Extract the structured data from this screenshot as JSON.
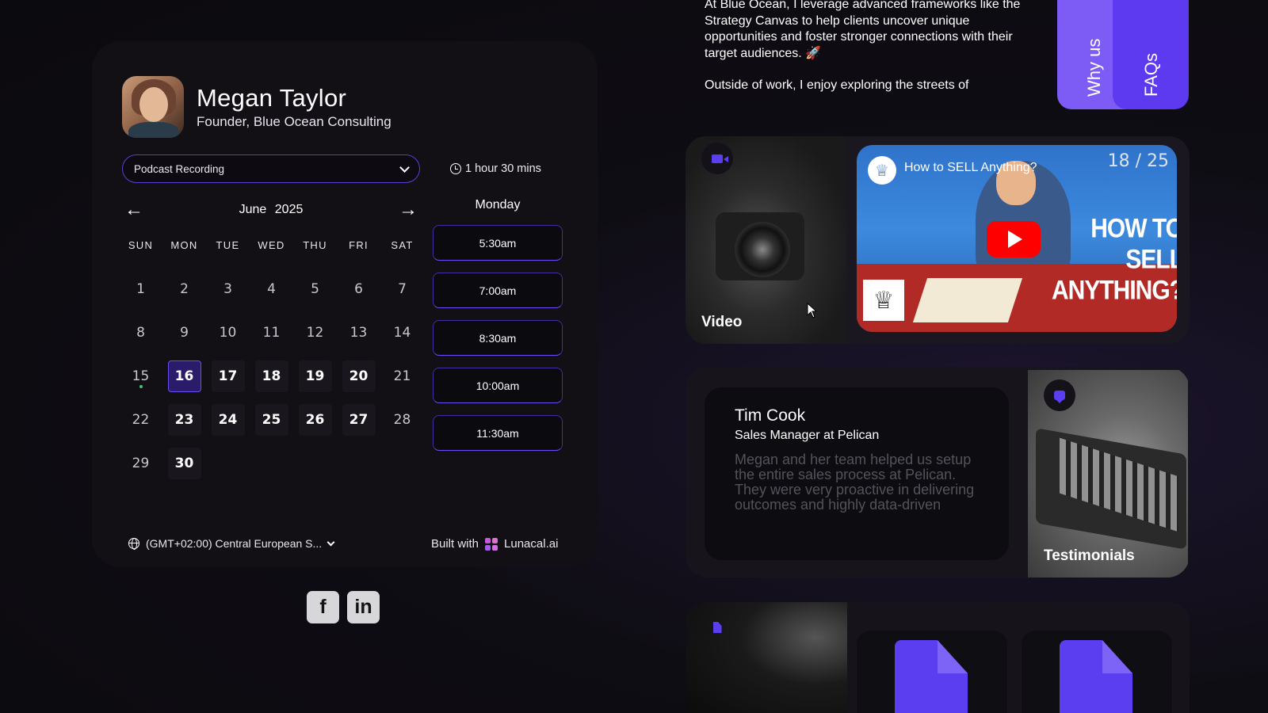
{
  "profile": {
    "name": "Megan Taylor",
    "role": "Founder, Blue Ocean Consulting"
  },
  "booking": {
    "event_type": "Podcast Recording",
    "duration": "1 hour 30 mins",
    "month": "June",
    "year": "2025",
    "weekdays": [
      "SUN",
      "MON",
      "TUE",
      "WED",
      "THU",
      "FRI",
      "SAT"
    ],
    "days": [
      {
        "d": "1",
        "state": "plain"
      },
      {
        "d": "2",
        "state": "plain"
      },
      {
        "d": "3",
        "state": "plain"
      },
      {
        "d": "4",
        "state": "plain"
      },
      {
        "d": "5",
        "state": "plain"
      },
      {
        "d": "6",
        "state": "plain"
      },
      {
        "d": "7",
        "state": "plain"
      },
      {
        "d": "8",
        "state": "plain"
      },
      {
        "d": "9",
        "state": "plain"
      },
      {
        "d": "10",
        "state": "plain"
      },
      {
        "d": "11",
        "state": "plain"
      },
      {
        "d": "12",
        "state": "plain"
      },
      {
        "d": "13",
        "state": "plain"
      },
      {
        "d": "14",
        "state": "plain"
      },
      {
        "d": "15",
        "state": "today"
      },
      {
        "d": "16",
        "state": "selected"
      },
      {
        "d": "17",
        "state": "avail"
      },
      {
        "d": "18",
        "state": "avail"
      },
      {
        "d": "19",
        "state": "avail"
      },
      {
        "d": "20",
        "state": "avail"
      },
      {
        "d": "21",
        "state": "plain"
      },
      {
        "d": "22",
        "state": "plain"
      },
      {
        "d": "23",
        "state": "avail"
      },
      {
        "d": "24",
        "state": "avail"
      },
      {
        "d": "25",
        "state": "avail"
      },
      {
        "d": "26",
        "state": "avail"
      },
      {
        "d": "27",
        "state": "avail"
      },
      {
        "d": "28",
        "state": "plain"
      },
      {
        "d": "29",
        "state": "plain"
      },
      {
        "d": "30",
        "state": "avail"
      }
    ],
    "selected_weekday": "Monday",
    "slots": [
      "5:30am",
      "7:00am",
      "8:30am",
      "10:00am",
      "11:30am"
    ],
    "timezone": "(GMT+02:00) Central European S...",
    "built_with_prefix": "Built with",
    "built_with_brand": "Lunacal.ai",
    "colors": {
      "accent": "#5b3ef0",
      "today_dot": "#3ec47a"
    }
  },
  "socials": [
    {
      "name": "facebook",
      "glyph": "f"
    },
    {
      "name": "linkedin",
      "glyph": "in"
    }
  ],
  "about": {
    "para1": "At Blue Ocean, I leverage advanced frameworks like the Strategy Canvas to help clients uncover unique opportunities and foster stronger connections with their target audiences. 🚀",
    "para2": "Outside of work, I enjoy exploring the streets of"
  },
  "tabs": {
    "why_us": "Why us",
    "faqs": "FAQs"
  },
  "video": {
    "caption": "Video",
    "yt_title": "How to SELL Anything?",
    "yt_counter": "18 / 25",
    "yt_headline_1": "HOW TO SELL",
    "yt_headline_2": "ANYTHING?"
  },
  "testimonial": {
    "name": "Tim Cook",
    "role": "Sales Manager at Pelican",
    "text": "Megan and her team helped us setup the entire sales process at Pelican. They were very proactive in delivering outcomes and highly data-driven",
    "caption": "Testimonials"
  }
}
